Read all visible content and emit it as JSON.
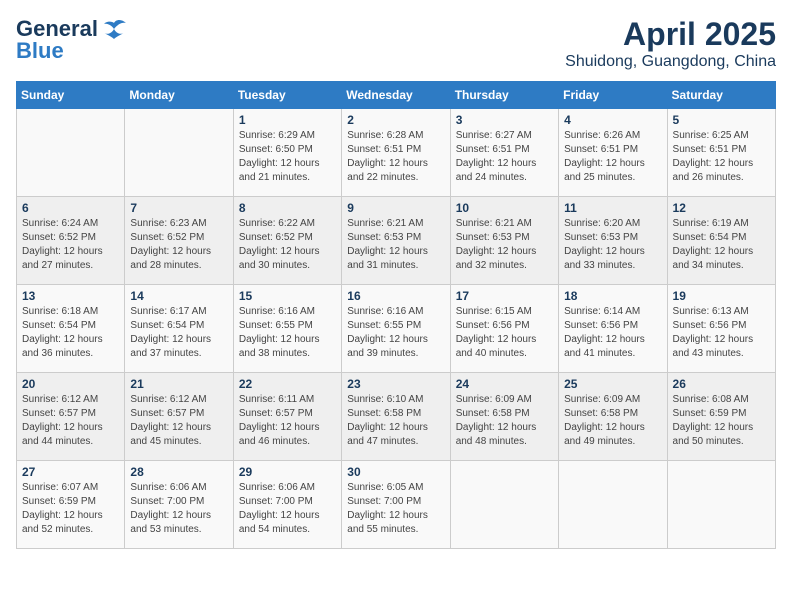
{
  "logo": {
    "general": "General",
    "blue": "Blue"
  },
  "title": "April 2025",
  "location": "Shuidong, Guangdong, China",
  "weekdays": [
    "Sunday",
    "Monday",
    "Tuesday",
    "Wednesday",
    "Thursday",
    "Friday",
    "Saturday"
  ],
  "weeks": [
    [
      {
        "day": "",
        "sunrise": "",
        "sunset": "",
        "daylight": ""
      },
      {
        "day": "",
        "sunrise": "",
        "sunset": "",
        "daylight": ""
      },
      {
        "day": "1",
        "sunrise": "Sunrise: 6:29 AM",
        "sunset": "Sunset: 6:50 PM",
        "daylight": "Daylight: 12 hours and 21 minutes."
      },
      {
        "day": "2",
        "sunrise": "Sunrise: 6:28 AM",
        "sunset": "Sunset: 6:51 PM",
        "daylight": "Daylight: 12 hours and 22 minutes."
      },
      {
        "day": "3",
        "sunrise": "Sunrise: 6:27 AM",
        "sunset": "Sunset: 6:51 PM",
        "daylight": "Daylight: 12 hours and 24 minutes."
      },
      {
        "day": "4",
        "sunrise": "Sunrise: 6:26 AM",
        "sunset": "Sunset: 6:51 PM",
        "daylight": "Daylight: 12 hours and 25 minutes."
      },
      {
        "day": "5",
        "sunrise": "Sunrise: 6:25 AM",
        "sunset": "Sunset: 6:51 PM",
        "daylight": "Daylight: 12 hours and 26 minutes."
      }
    ],
    [
      {
        "day": "6",
        "sunrise": "Sunrise: 6:24 AM",
        "sunset": "Sunset: 6:52 PM",
        "daylight": "Daylight: 12 hours and 27 minutes."
      },
      {
        "day": "7",
        "sunrise": "Sunrise: 6:23 AM",
        "sunset": "Sunset: 6:52 PM",
        "daylight": "Daylight: 12 hours and 28 minutes."
      },
      {
        "day": "8",
        "sunrise": "Sunrise: 6:22 AM",
        "sunset": "Sunset: 6:52 PM",
        "daylight": "Daylight: 12 hours and 30 minutes."
      },
      {
        "day": "9",
        "sunrise": "Sunrise: 6:21 AM",
        "sunset": "Sunset: 6:53 PM",
        "daylight": "Daylight: 12 hours and 31 minutes."
      },
      {
        "day": "10",
        "sunrise": "Sunrise: 6:21 AM",
        "sunset": "Sunset: 6:53 PM",
        "daylight": "Daylight: 12 hours and 32 minutes."
      },
      {
        "day": "11",
        "sunrise": "Sunrise: 6:20 AM",
        "sunset": "Sunset: 6:53 PM",
        "daylight": "Daylight: 12 hours and 33 minutes."
      },
      {
        "day": "12",
        "sunrise": "Sunrise: 6:19 AM",
        "sunset": "Sunset: 6:54 PM",
        "daylight": "Daylight: 12 hours and 34 minutes."
      }
    ],
    [
      {
        "day": "13",
        "sunrise": "Sunrise: 6:18 AM",
        "sunset": "Sunset: 6:54 PM",
        "daylight": "Daylight: 12 hours and 36 minutes."
      },
      {
        "day": "14",
        "sunrise": "Sunrise: 6:17 AM",
        "sunset": "Sunset: 6:54 PM",
        "daylight": "Daylight: 12 hours and 37 minutes."
      },
      {
        "day": "15",
        "sunrise": "Sunrise: 6:16 AM",
        "sunset": "Sunset: 6:55 PM",
        "daylight": "Daylight: 12 hours and 38 minutes."
      },
      {
        "day": "16",
        "sunrise": "Sunrise: 6:16 AM",
        "sunset": "Sunset: 6:55 PM",
        "daylight": "Daylight: 12 hours and 39 minutes."
      },
      {
        "day": "17",
        "sunrise": "Sunrise: 6:15 AM",
        "sunset": "Sunset: 6:56 PM",
        "daylight": "Daylight: 12 hours and 40 minutes."
      },
      {
        "day": "18",
        "sunrise": "Sunrise: 6:14 AM",
        "sunset": "Sunset: 6:56 PM",
        "daylight": "Daylight: 12 hours and 41 minutes."
      },
      {
        "day": "19",
        "sunrise": "Sunrise: 6:13 AM",
        "sunset": "Sunset: 6:56 PM",
        "daylight": "Daylight: 12 hours and 43 minutes."
      }
    ],
    [
      {
        "day": "20",
        "sunrise": "Sunrise: 6:12 AM",
        "sunset": "Sunset: 6:57 PM",
        "daylight": "Daylight: 12 hours and 44 minutes."
      },
      {
        "day": "21",
        "sunrise": "Sunrise: 6:12 AM",
        "sunset": "Sunset: 6:57 PM",
        "daylight": "Daylight: 12 hours and 45 minutes."
      },
      {
        "day": "22",
        "sunrise": "Sunrise: 6:11 AM",
        "sunset": "Sunset: 6:57 PM",
        "daylight": "Daylight: 12 hours and 46 minutes."
      },
      {
        "day": "23",
        "sunrise": "Sunrise: 6:10 AM",
        "sunset": "Sunset: 6:58 PM",
        "daylight": "Daylight: 12 hours and 47 minutes."
      },
      {
        "day": "24",
        "sunrise": "Sunrise: 6:09 AM",
        "sunset": "Sunset: 6:58 PM",
        "daylight": "Daylight: 12 hours and 48 minutes."
      },
      {
        "day": "25",
        "sunrise": "Sunrise: 6:09 AM",
        "sunset": "Sunset: 6:58 PM",
        "daylight": "Daylight: 12 hours and 49 minutes."
      },
      {
        "day": "26",
        "sunrise": "Sunrise: 6:08 AM",
        "sunset": "Sunset: 6:59 PM",
        "daylight": "Daylight: 12 hours and 50 minutes."
      }
    ],
    [
      {
        "day": "27",
        "sunrise": "Sunrise: 6:07 AM",
        "sunset": "Sunset: 6:59 PM",
        "daylight": "Daylight: 12 hours and 52 minutes."
      },
      {
        "day": "28",
        "sunrise": "Sunrise: 6:06 AM",
        "sunset": "Sunset: 7:00 PM",
        "daylight": "Daylight: 12 hours and 53 minutes."
      },
      {
        "day": "29",
        "sunrise": "Sunrise: 6:06 AM",
        "sunset": "Sunset: 7:00 PM",
        "daylight": "Daylight: 12 hours and 54 minutes."
      },
      {
        "day": "30",
        "sunrise": "Sunrise: 6:05 AM",
        "sunset": "Sunset: 7:00 PM",
        "daylight": "Daylight: 12 hours and 55 minutes."
      },
      {
        "day": "",
        "sunrise": "",
        "sunset": "",
        "daylight": ""
      },
      {
        "day": "",
        "sunrise": "",
        "sunset": "",
        "daylight": ""
      },
      {
        "day": "",
        "sunrise": "",
        "sunset": "",
        "daylight": ""
      }
    ]
  ]
}
